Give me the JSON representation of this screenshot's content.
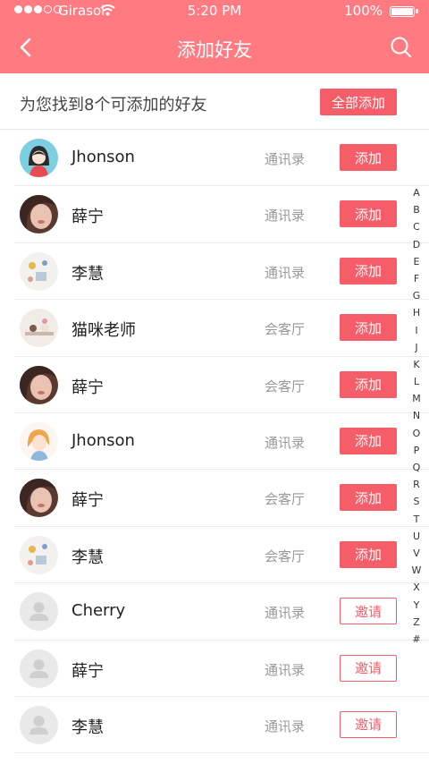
{
  "status_bar": {
    "carrier": "Girasol",
    "time": "5:20 PM",
    "battery": "100%",
    "signal_bars": 3,
    "signal_total": 5,
    "battery_level": 1.0
  },
  "nav": {
    "title": "添加好友",
    "back_icon": "chevron-left-icon",
    "search_icon": "search-icon"
  },
  "summary": {
    "text": "为您找到8个可添加的好友",
    "add_all_label": "全部添加"
  },
  "colors": {
    "header": "#ff7b81",
    "accent": "#f55e68",
    "secondary_text": "#999999"
  },
  "friends": [
    {
      "name": "Jhonson",
      "source": "通讯录",
      "action": "添加",
      "action_type": "add",
      "avatar": "cartoon-girl"
    },
    {
      "name": "薛宁",
      "source": "通讯录",
      "action": "添加",
      "action_type": "add",
      "avatar": "photo-portrait"
    },
    {
      "name": "李慧",
      "source": "通讯录",
      "action": "添加",
      "action_type": "add",
      "avatar": "photo-still-life"
    },
    {
      "name": "猫咪老师",
      "source": "会客厅",
      "action": "添加",
      "action_type": "add",
      "avatar": "photo-cat-scene"
    },
    {
      "name": "薛宁",
      "source": "会客厅",
      "action": "添加",
      "action_type": "add",
      "avatar": "photo-portrait"
    },
    {
      "name": "Jhonson",
      "source": "通讯录",
      "action": "添加",
      "action_type": "add",
      "avatar": "illustration-girl"
    },
    {
      "name": "薛宁",
      "source": "会客厅",
      "action": "添加",
      "action_type": "add",
      "avatar": "photo-portrait"
    },
    {
      "name": "李慧",
      "source": "会客厅",
      "action": "添加",
      "action_type": "add",
      "avatar": "photo-still-life"
    },
    {
      "name": "Cherry",
      "source": "通讯录",
      "action": "邀请",
      "action_type": "invite",
      "avatar": "default-user"
    },
    {
      "name": "薛宁",
      "source": "通讯录",
      "action": "邀请",
      "action_type": "invite",
      "avatar": "default-user"
    },
    {
      "name": "李慧",
      "source": "通讯录",
      "action": "邀请",
      "action_type": "invite",
      "avatar": "default-user"
    }
  ],
  "index_letters": [
    "A",
    "B",
    "C",
    "D",
    "E",
    "F",
    "G",
    "H",
    "I",
    "J",
    "K",
    "L",
    "M",
    "N",
    "O",
    "P",
    "Q",
    "R",
    "S",
    "T",
    "U",
    "V",
    "W",
    "X",
    "Y",
    "Z",
    "#"
  ]
}
